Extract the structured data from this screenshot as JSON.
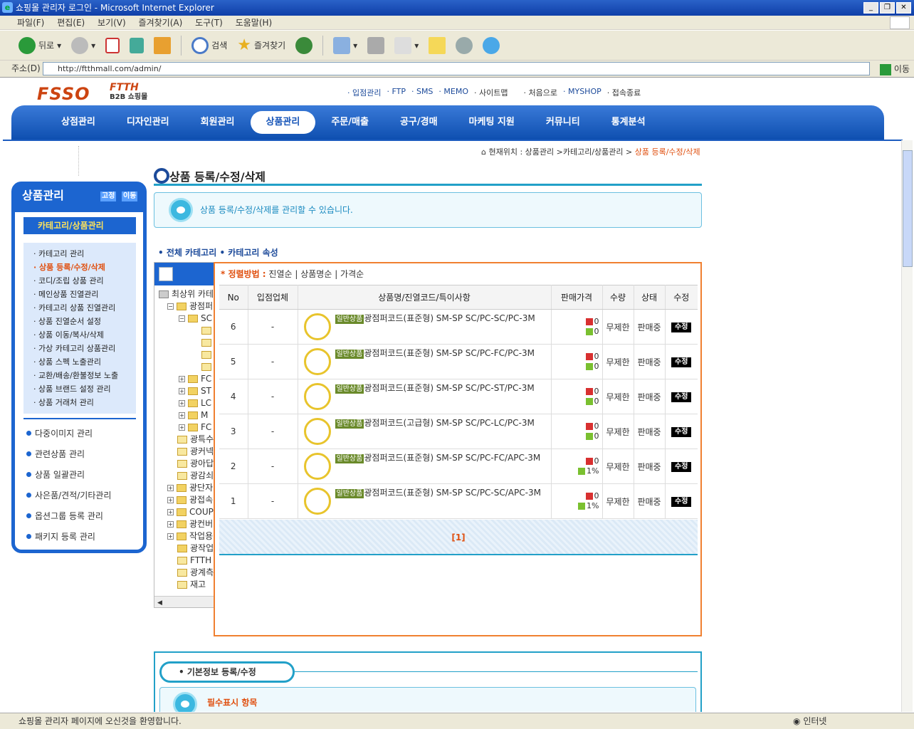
{
  "window": {
    "title": "쇼핑몰 관리자 로그인 - Microsoft Internet Explorer"
  },
  "menu": [
    "파일(F)",
    "편집(E)",
    "보기(V)",
    "즐겨찾기(A)",
    "도구(T)",
    "도움말(H)"
  ],
  "toolbar": {
    "back": "뒤로",
    "search": "검색",
    "favorites": "즐겨찾기"
  },
  "address": {
    "label": "주소(D)",
    "url": "http://ftthmall.com/admin/",
    "go": "이동"
  },
  "header": {
    "logo": "FSSO",
    "brand": "FTTH",
    "brand_sub": "B2B 쇼핑몰",
    "links": [
      "· 입점관리",
      "· FTP",
      "· SMS",
      "· MEMO",
      "· 사이트맵",
      "· 처음으로",
      "· MYSHOP",
      "· 접속종료"
    ]
  },
  "gnb": [
    "상점관리",
    "디자인관리",
    "회원관리",
    "상품관리",
    "주문/매출",
    "공구/경매",
    "마케팅 지원",
    "커뮤니티",
    "통계분석"
  ],
  "breadcrumb": {
    "prefix": "현재위치 : 상품관리 >카테고리/상품관리 > ",
    "current": "상품 등록/수정/삭제"
  },
  "sidebar": {
    "title": "상품관리",
    "btn_fix": "고정",
    "btn_move": "이동",
    "sub_title": "카테고리/상품관리",
    "items": [
      "카테고리 관리",
      "상품 등록/수정/삭제",
      "코디/조립 상품 관리",
      "메인상품 진열관리",
      "카테고리 상품 진열관리",
      "상품 진열순서 설정",
      "상품 이동/복사/삭제",
      "가상 카테고리 상품관리",
      "상품 스펙 노출관리",
      "교환/배송/환불정보 노출",
      "상품 브랜드 설정 관리",
      "상품 거래처 관리"
    ],
    "menus": [
      "다중이미지 관리",
      "관련상품 관리",
      "상품 일괄관리",
      "사은품/견적/기타관리",
      "옵션그룹 등록 관리",
      "패키지 등록 관리"
    ]
  },
  "page": {
    "title": "상품 등록/수정/삭제",
    "info": "상품 등록/수정/삭제를 관리할 수 있습니다.",
    "cat_links": "• 전체 카테고리  • 카테고리 속성"
  },
  "tree": {
    "nodes": [
      "최상위 카테",
      "광점퍼",
      "SC",
      "",
      "",
      "",
      "",
      "FC",
      "ST",
      "LC",
      "M",
      "FC",
      "광특수",
      "광커넥",
      "광아답",
      "광감쇠",
      "광단자",
      "광접속",
      "COUP",
      "광컨버",
      "작업용",
      "광작업",
      "FTTH",
      "광계측",
      "재고"
    ]
  },
  "popup": {
    "sort_label": "정렬방법 :",
    "sort_options": "진열순 | 상품명순 | 가격순",
    "headers": [
      "No",
      "입점업체",
      "상품명/진열코드/특이사항",
      "판매가격",
      "수량",
      "상태",
      "수정"
    ],
    "rows": [
      {
        "no": "6",
        "vendor": "-",
        "badge": "일반상품",
        "name": "광점퍼코드(표준형) SM-SP SC/PC-SC/PC-3M",
        "p1": "0",
        "p2": "0",
        "qty": "무제한",
        "status": "판매중",
        "edit": "수정"
      },
      {
        "no": "5",
        "vendor": "-",
        "badge": "일반상품",
        "name": "광점퍼코드(표준형) SM-SP SC/PC-FC/PC-3M",
        "p1": "0",
        "p2": "0",
        "qty": "무제한",
        "status": "판매중",
        "edit": "수정"
      },
      {
        "no": "4",
        "vendor": "-",
        "badge": "일반상품",
        "name": "광점퍼코드(표준형) SM-SP SC/PC-ST/PC-3M",
        "p1": "0",
        "p2": "0",
        "qty": "무제한",
        "status": "판매중",
        "edit": "수정"
      },
      {
        "no": "3",
        "vendor": "-",
        "badge": "일반상품",
        "name": "광점퍼코드(고급형) SM-SP SC/PC-LC/PC-3M",
        "p1": "0",
        "p2": "0",
        "qty": "무제한",
        "status": "판매중",
        "edit": "수정"
      },
      {
        "no": "2",
        "vendor": "-",
        "badge": "일반상품",
        "name": "광점퍼코드(표준형) SM-SP SC/PC-FC/APC-3M",
        "p1": "0",
        "p2": "1%",
        "qty": "무제한",
        "status": "판매중",
        "edit": "수정"
      },
      {
        "no": "1",
        "vendor": "-",
        "badge": "일반상품",
        "name": "광점퍼코드(표준형) SM-SP SC/PC-SC/APC-3M",
        "p1": "0",
        "p2": "1%",
        "qty": "무제한",
        "status": "판매중",
        "edit": "수정"
      }
    ],
    "paging": "[1]"
  },
  "basic": {
    "tab": "• 기본정보 등록/수정",
    "required": "필수표시 항목"
  },
  "status": {
    "text": "쇼핑몰 관리자 페이지에 오신것을 환영합니다.",
    "zone": "인터넷"
  }
}
